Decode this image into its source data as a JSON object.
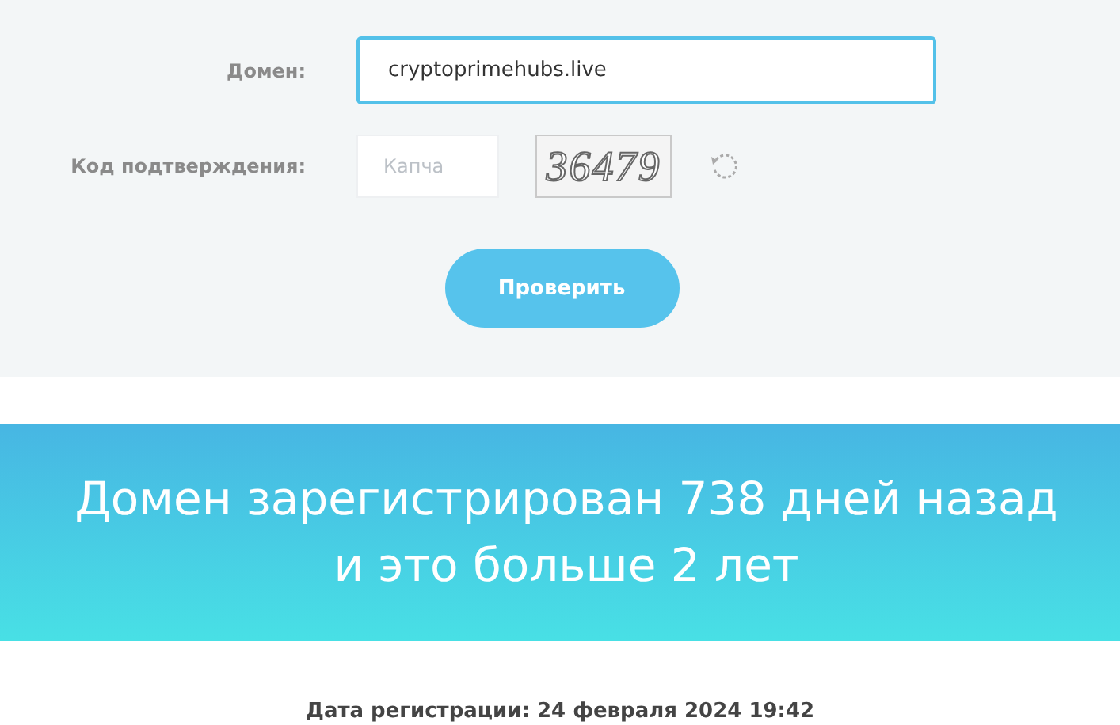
{
  "form": {
    "domain_label": "Домен:",
    "domain_value": "cryptoprimehubs.live",
    "code_label": "Код подтверждения:",
    "captcha_placeholder": "Капча",
    "captcha_code": "36479",
    "submit": "Проверить"
  },
  "banner": {
    "lines": [
      "Домен зарегистрирован 738 дней назад",
      "и это больше 2 лет"
    ]
  },
  "registration": {
    "text": "Дата регистрации: 24 февраля 2024 19:42"
  }
}
